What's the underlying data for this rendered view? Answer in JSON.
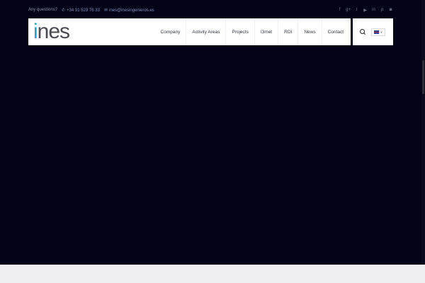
{
  "topbar": {
    "question": "Any questions?",
    "phone": "+34 91 523 76 33",
    "email": "ines@inesingenieros.es",
    "social_icons": [
      "facebook-icon",
      "google-plus-icon",
      "twitter-icon",
      "youtube-icon",
      "linkedin-icon",
      "pinterest-icon",
      "instagram-icon"
    ]
  },
  "logo": {
    "i": "i",
    "rest": "nes"
  },
  "menu": {
    "items": [
      {
        "label": "Company"
      },
      {
        "label": "Activity Areas"
      },
      {
        "label": "Projects"
      },
      {
        "label": "I3met"
      },
      {
        "label": "RDI"
      },
      {
        "label": "News"
      },
      {
        "label": "Contact"
      }
    ]
  },
  "language": {
    "flag": "uk-flag-icon"
  },
  "colors": {
    "background": "#030318",
    "accent": "#11a8c9",
    "footer": "#efeff1"
  }
}
